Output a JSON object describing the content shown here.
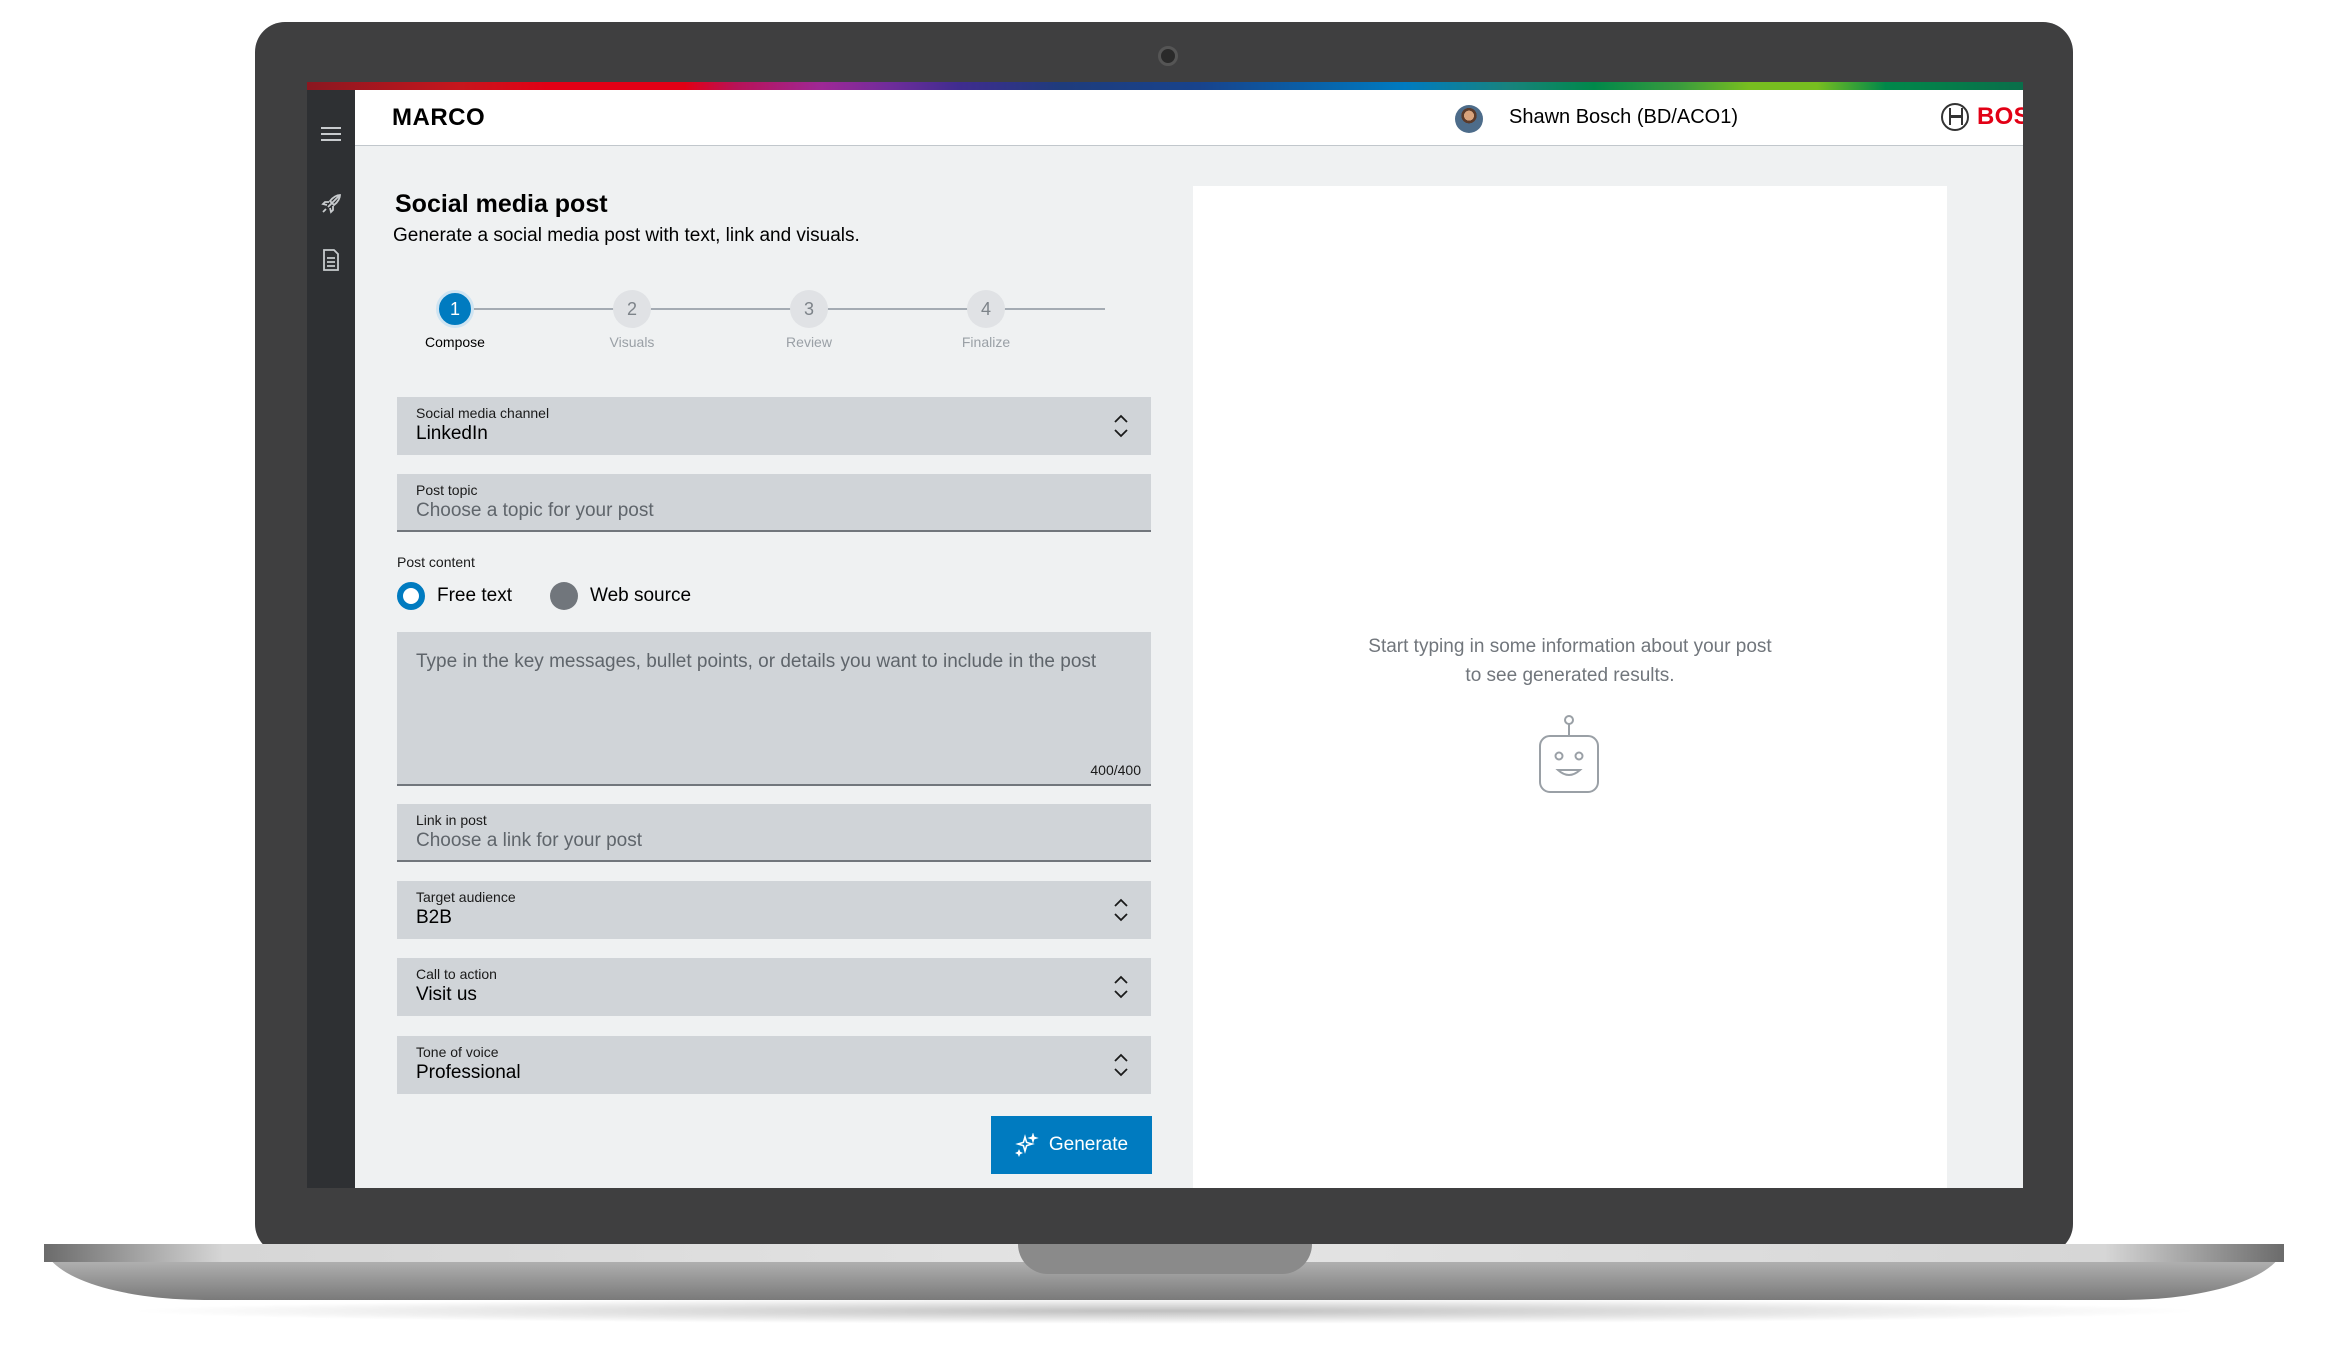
{
  "header": {
    "app_title": "MARCO",
    "user_name": "Shawn Bosch (BD/ACO1)",
    "brand": "BOSCH",
    "brand_color": "#e20015"
  },
  "sidebar": {
    "items": [
      {
        "icon": "menu-icon"
      },
      {
        "icon": "rocket-icon"
      },
      {
        "icon": "document-icon"
      }
    ]
  },
  "form": {
    "title": "Social media post",
    "subtitle": "Generate a social media post with text, link and visuals.",
    "steps": [
      {
        "number": "1",
        "label": "Compose",
        "active": true
      },
      {
        "number": "2",
        "label": "Visuals",
        "active": false
      },
      {
        "number": "3",
        "label": "Review",
        "active": false
      },
      {
        "number": "4",
        "label": "Finalize",
        "active": false
      }
    ],
    "channel": {
      "label": "Social media channel",
      "value": "LinkedIn"
    },
    "topic": {
      "label": "Post topic",
      "placeholder": "Choose a topic for your post"
    },
    "post_content": {
      "label": "Post content",
      "options": [
        "Free text",
        "Web source"
      ],
      "selected": "Free text"
    },
    "details": {
      "placeholder": "Type in the key messages, bullet points, or details you want to include in the post",
      "counter": "400/400"
    },
    "link": {
      "label": "Link in post",
      "placeholder": "Choose a link for your post"
    },
    "audience": {
      "label": "Target audience",
      "value": "B2B"
    },
    "cta": {
      "label": "Call to action",
      "value": "Visit us"
    },
    "tone": {
      "label": "Tone of voice",
      "value": "Professional"
    },
    "generate_label": "Generate",
    "accent_color": "#007bc0"
  },
  "results": {
    "empty_line1": "Start typing in some information about your post",
    "empty_line2": "to see generated results."
  }
}
